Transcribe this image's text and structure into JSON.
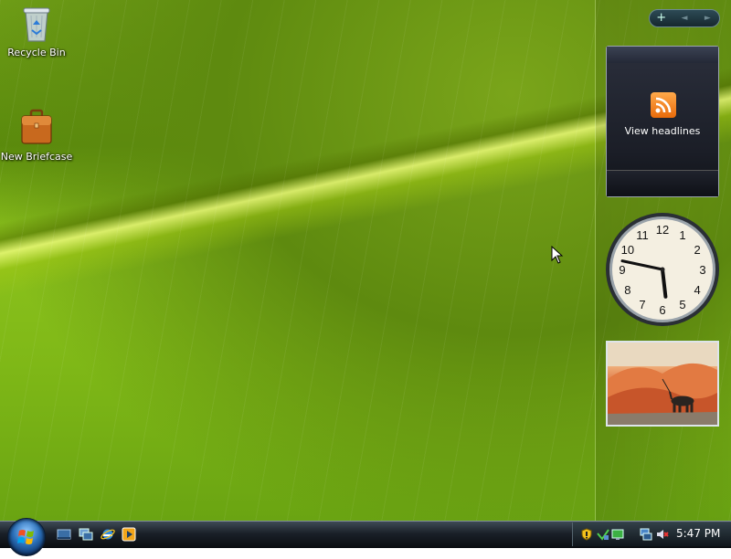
{
  "desktop": {
    "icons": [
      {
        "label": "Recycle Bin",
        "icon": "recycle-bin-icon"
      },
      {
        "label": "New Briefcase",
        "icon": "briefcase-icon"
      }
    ]
  },
  "sidebar": {
    "controls": {
      "add": "+",
      "prev": "◄",
      "next": "►"
    },
    "feed_gadget": {
      "label": "View headlines",
      "icon": "rss-feed-icon"
    },
    "clock_gadget": {
      "numbers": [
        "12",
        "1",
        "2",
        "3",
        "4",
        "5",
        "6",
        "7",
        "8",
        "9",
        "10",
        "11"
      ],
      "hour": 5,
      "minute": 47
    },
    "slideshow_gadget": {
      "icon": "desert-oryx-photo"
    }
  },
  "taskbar": {
    "start": "start-orb-icon",
    "quick_launch": [
      "show-desktop-icon",
      "switch-windows-icon",
      "internet-explorer-icon",
      "media-player-icon"
    ],
    "tray_icons": [
      "security-shield-icon",
      "network-icon",
      "display-icon",
      "monitor-icon",
      "volume-muted-icon"
    ],
    "time": "5:47 PM"
  },
  "colors": {
    "taskbar_dark": "#090c10",
    "leaf_green": "#7fb817",
    "rss_orange": "#f08a24"
  }
}
